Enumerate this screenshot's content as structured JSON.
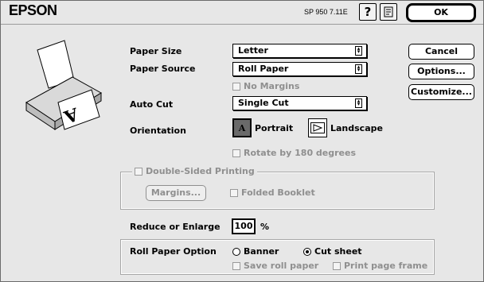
{
  "brand": "EPSON",
  "version": "SP 950 7.11E",
  "buttons": {
    "ok": "OK",
    "cancel": "Cancel",
    "options": "Options...",
    "customize": "Customize..."
  },
  "paper_size": {
    "label": "Paper Size",
    "value": "Letter"
  },
  "paper_source": {
    "label": "Paper Source",
    "value": "Roll Paper"
  },
  "no_margins": "No Margins",
  "auto_cut": {
    "label": "Auto Cut",
    "value": "Single Cut"
  },
  "orientation": {
    "label": "Orientation",
    "portrait": "Portrait",
    "landscape": "Landscape"
  },
  "rotate": "Rotate by 180 degrees",
  "double_sided": {
    "label": "Double-Sided Printing",
    "margins": "Margins...",
    "folded": "Folded Booklet"
  },
  "reduce": {
    "label": "Reduce or Enlarge",
    "value": "100",
    "unit": "%"
  },
  "roll_paper": {
    "label": "Roll Paper Option",
    "banner": "Banner",
    "cut_sheet": "Cut sheet",
    "save": "Save roll paper",
    "frame": "Print page frame",
    "selected": "Cut sheet"
  }
}
